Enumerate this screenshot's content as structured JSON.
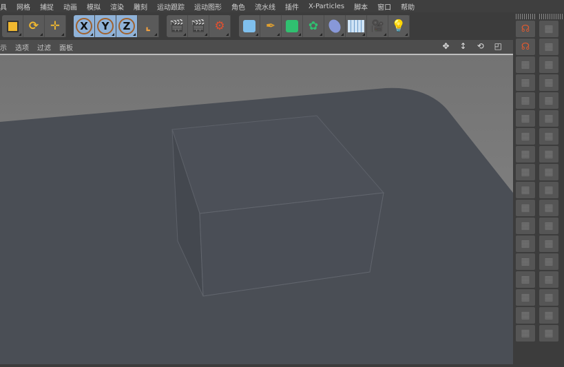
{
  "menu": [
    "具",
    "网格",
    "捕捉",
    "动画",
    "模拟",
    "渲染",
    "雕刻",
    "运动跟踪",
    "运动图形",
    "角色",
    "流水线",
    "插件",
    "X-Particles",
    "脚本",
    "窗口",
    "帮助"
  ],
  "toolbar": {
    "axis_x": "X",
    "axis_y": "Y",
    "axis_z": "Z",
    "icons": [
      "model-mode-icon",
      "rotate-icon",
      "move-icon",
      "axis-x-icon",
      "axis-y-icon",
      "axis-z-icon",
      "coordinate-system-icon",
      "render-view-icon",
      "render-picture-viewer-icon",
      "render-settings-icon",
      "cube-icon",
      "pen-icon",
      "subdivision-icon",
      "cloner-icon",
      "deformer-icon",
      "floor-icon",
      "camera-icon",
      "light-icon"
    ]
  },
  "viewport_menu": [
    "示",
    "选项",
    "过滤",
    "面板"
  ],
  "colors": {
    "accent": "#8fb2d8",
    "floor": "#4a4e55",
    "sky": "#7e7e7e"
  }
}
